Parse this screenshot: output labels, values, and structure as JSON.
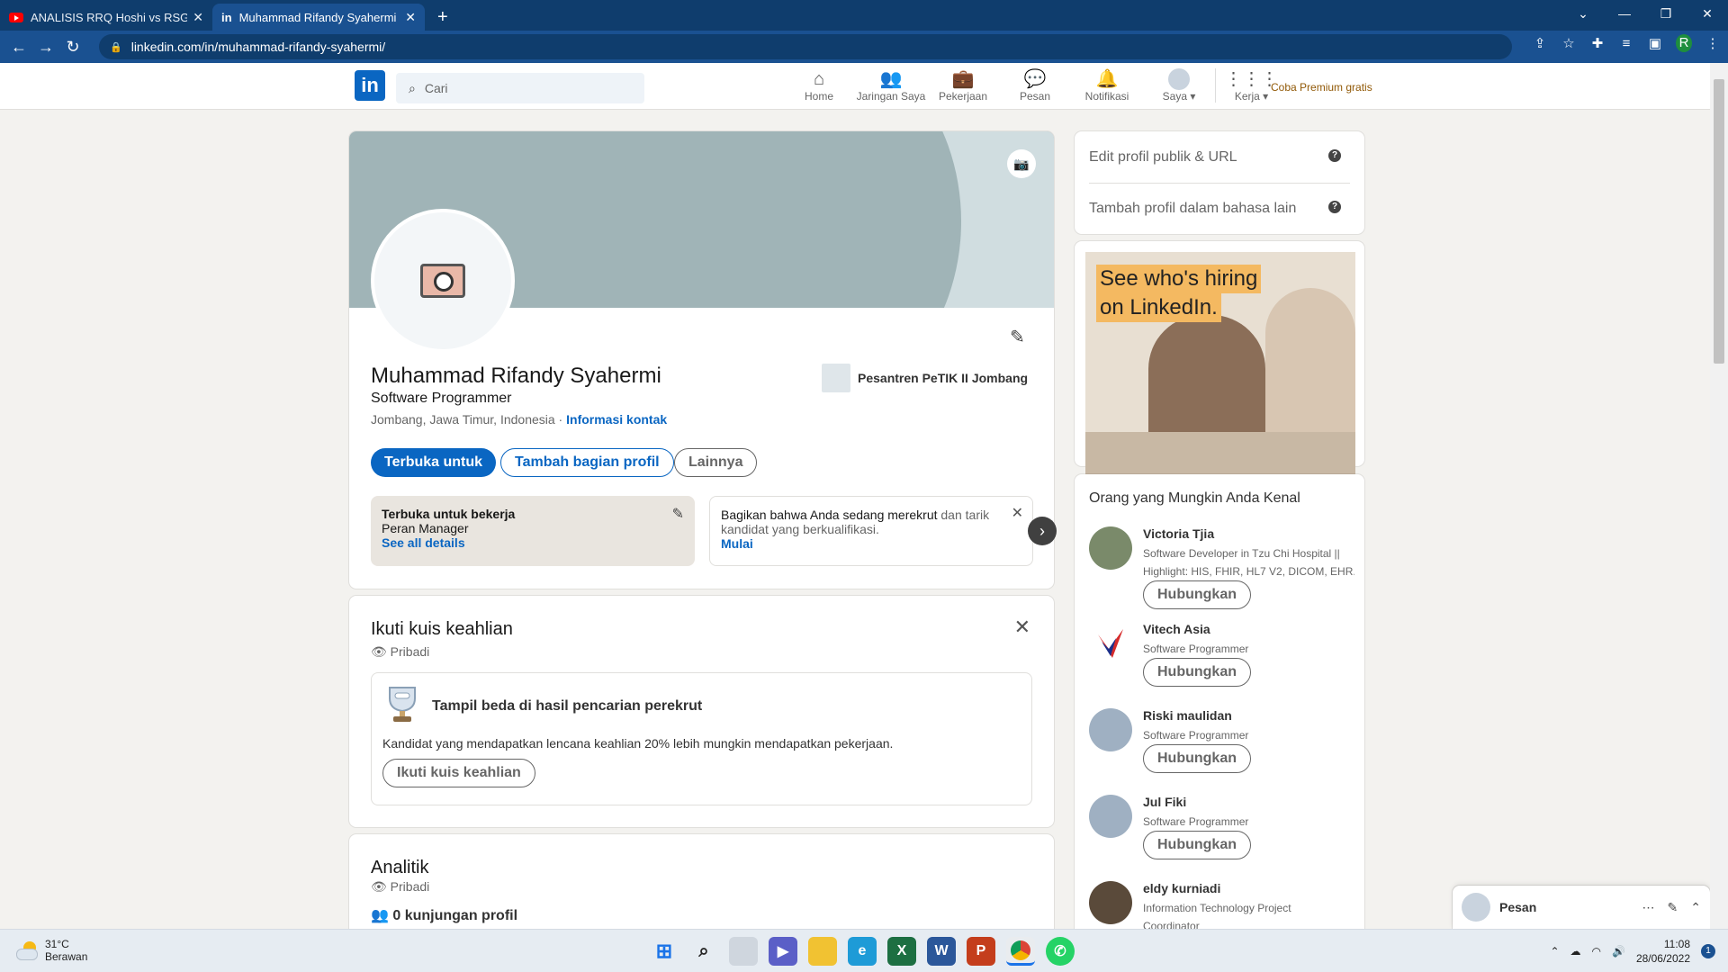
{
  "browser": {
    "tabs": [
      {
        "title": "ANALISIS RRQ Hoshi vs RSG PH |",
        "active": false,
        "icon": "youtube-icon"
      },
      {
        "title": "Muhammad Rifandy Syahermi | L",
        "active": true,
        "icon": "linkedin-icon"
      }
    ],
    "url": "linkedin.com/in/muhammad-rifandy-syahermi/",
    "profile_initial": "R"
  },
  "header": {
    "logo": "in",
    "search_placeholder": "Cari",
    "nav": [
      {
        "label": "Home",
        "icon": "home-icon"
      },
      {
        "label": "Jaringan Saya",
        "icon": "network-icon"
      },
      {
        "label": "Pekerjaan",
        "icon": "briefcase-icon"
      },
      {
        "label": "Pesan",
        "icon": "message-icon"
      },
      {
        "label": "Notifikasi",
        "icon": "bell-icon"
      },
      {
        "label": "Saya ▾",
        "icon": "avatar-icon"
      },
      {
        "label": "Kerja ▾",
        "icon": "grid-icon"
      }
    ],
    "premium": "Coba Premium gratis"
  },
  "profile": {
    "name": "Muhammad Rifandy Syahermi",
    "headline": "Software Programmer",
    "location": "Jombang, Jawa Timur, Indonesia ·",
    "contact_link": "Informasi kontak",
    "education": "Pesantren PeTIK II Jombang",
    "buttons": {
      "open_to": "Terbuka untuk",
      "add_section": "Tambah bagian profil",
      "more": "Lainnya"
    },
    "open_to_work": {
      "title": "Terbuka untuk bekerja",
      "role": "Peran Manager",
      "link": "See all details"
    },
    "share_hiring": {
      "bold": "Bagikan bahwa Anda sedang merekrut",
      "rest": " dan tarik kandidat yang berkualifikasi.",
      "link": "Mulai"
    }
  },
  "skill_quiz": {
    "title": "Ikuti kuis keahlian",
    "visibility": "Pribadi",
    "heading": "Tampil beda di hasil pencarian perekrut",
    "text": "Kandidat yang mendapatkan lencana keahlian 20% lebih mungkin mendapatkan pekerjaan.",
    "button": "Ikuti kuis keahlian"
  },
  "analytics": {
    "title": "Analitik",
    "visibility": "Pribadi",
    "profile_views": "0 kunjungan profil"
  },
  "sidebar": {
    "links": [
      "Edit profil publik & URL",
      "Tambah profil dalam bahasa lain"
    ],
    "ad": {
      "line1": "See who's hiring",
      "line2": "on LinkedIn."
    },
    "pymk_title": "Orang yang Mungkin Anda Kenal",
    "connect_label": "Hubungkan",
    "people": [
      {
        "name": "Victoria Tjia",
        "desc1": "Software Developer in Tzu Chi Hospital ||",
        "desc2": "Highlight: HIS, FHIR, HL7 V2, DICOM, EHR..."
      },
      {
        "name": "Vitech Asia",
        "desc1": "Software Programmer",
        "desc2": ""
      },
      {
        "name": "Riski maulidan",
        "desc1": "Software Programmer",
        "desc2": ""
      },
      {
        "name": "Jul Fiki",
        "desc1": "Software Programmer",
        "desc2": ""
      },
      {
        "name": "eldy kurniadi",
        "desc1": "Information Technology Project",
        "desc2": "Coordinator"
      }
    ]
  },
  "messaging": {
    "label": "Pesan"
  },
  "taskbar": {
    "temp": "31°C",
    "weather": "Berawan",
    "time": "11:08",
    "date": "28/06/2022",
    "notifications": "1"
  },
  "colors": {
    "linkedin_blue": "#0a66c2",
    "chrome_tab_bar": "#0f3d6d",
    "chrome_toolbar": "#1a5191",
    "premium_gold": "#915907"
  }
}
